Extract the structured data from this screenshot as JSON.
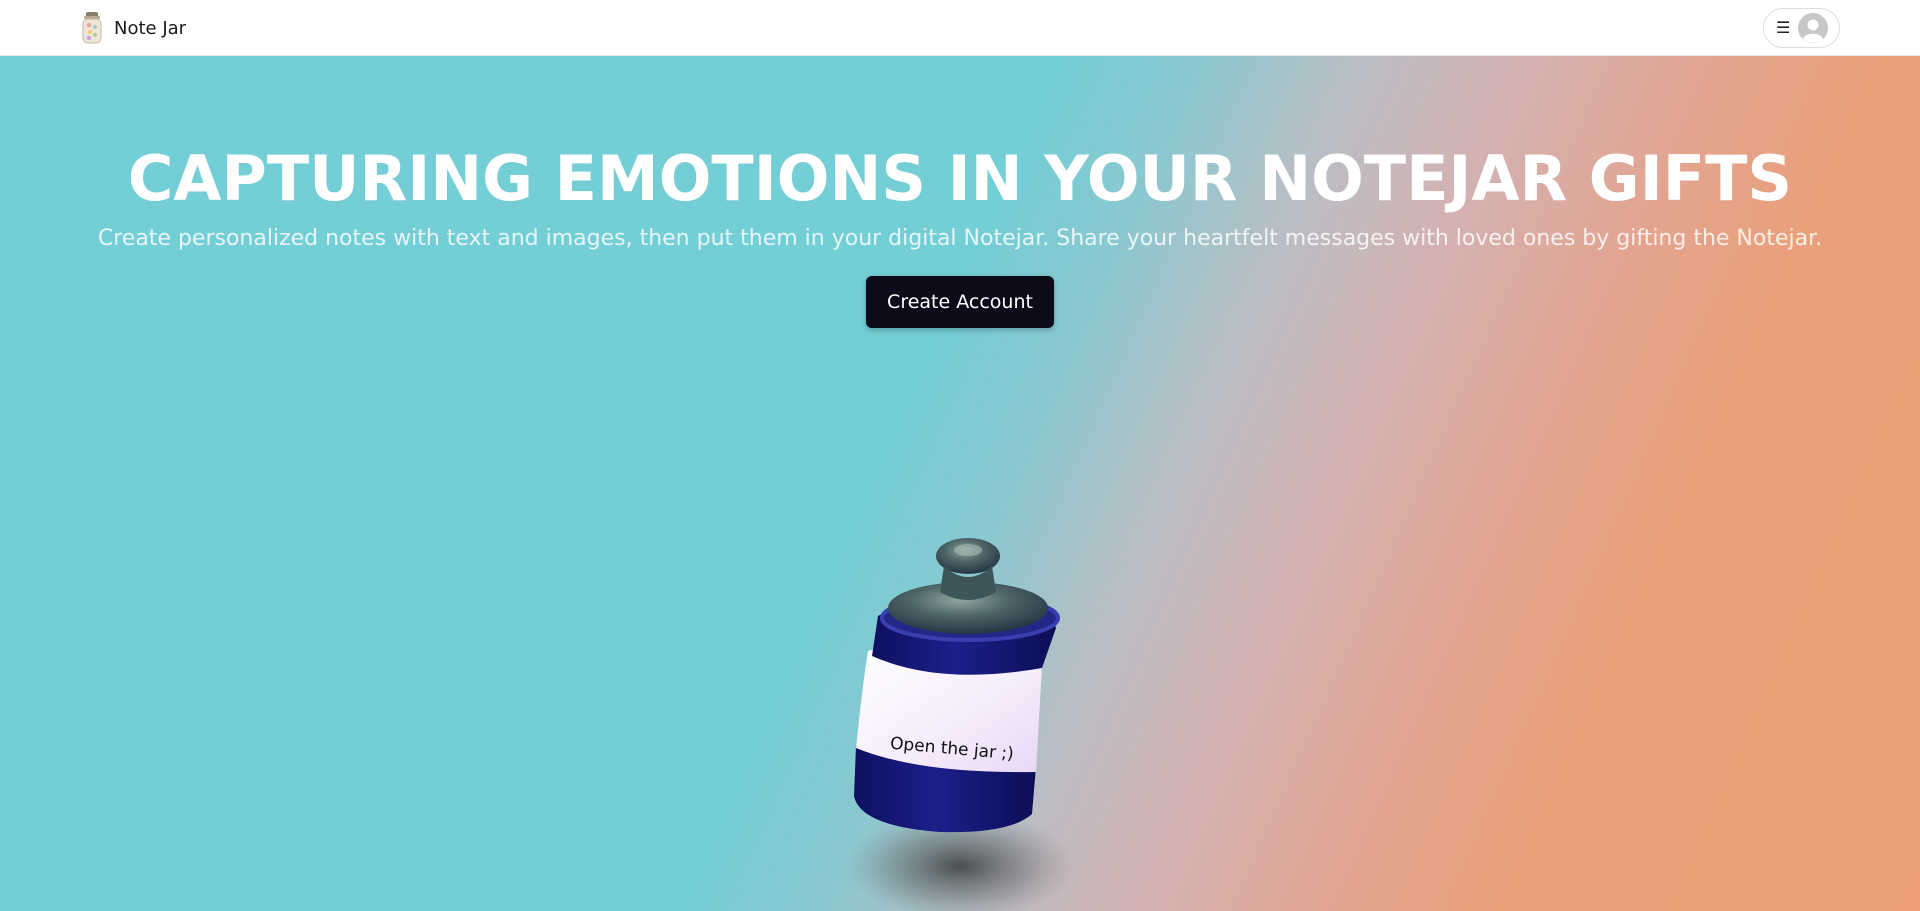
{
  "header": {
    "brand_name": "Note Jar",
    "brand_icon": "jar-logo-icon",
    "menu_icon": "hamburger-icon",
    "avatar_icon": "user-avatar-icon"
  },
  "hero": {
    "title": "CAPTURING EMOTIONS IN YOUR NOTEJAR GIFTS",
    "subtitle": "Create personalized notes with text and images, then put them in your digital Notejar. Share your heartfelt messages with loved ones by gifting the Notejar.",
    "cta_label": "Create Account",
    "jar_label": "Open the jar ;)"
  },
  "colors": {
    "teal": "#73ced6",
    "orange": "#eb9f73",
    "button": "#0b0b1a",
    "jar_blue": "#1b1f8a"
  }
}
